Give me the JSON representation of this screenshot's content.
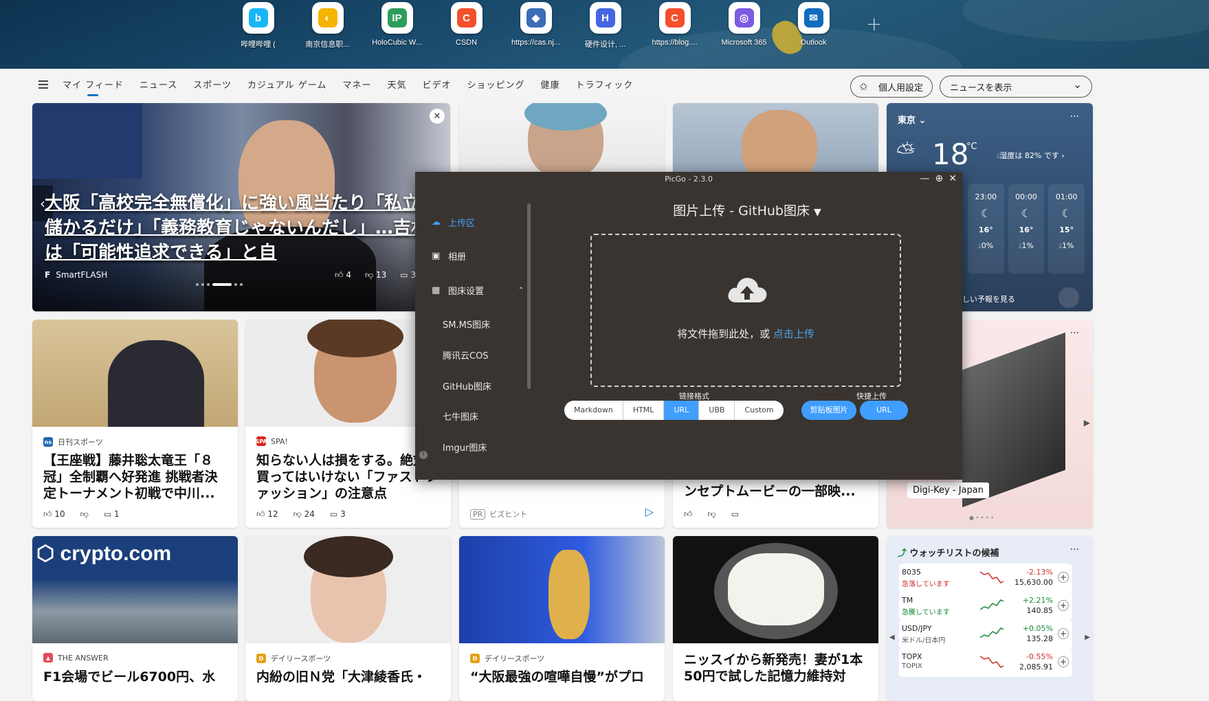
{
  "shortcuts": [
    {
      "label": "哔哩哔哩 (",
      "icon": "bilibili-icon",
      "color": "#19b6f6",
      "glyph": "b"
    },
    {
      "label": "南京信息职...",
      "icon": "njcit-icon",
      "color": "#f5b400",
      "glyph": "◐"
    },
    {
      "label": "HoloCubic W...",
      "icon": "holocubic-icon",
      "color": "#2e9d5c",
      "glyph": "IP"
    },
    {
      "label": "CSDN",
      "icon": "csdn-icon",
      "color": "#f44f2b",
      "glyph": "C"
    },
    {
      "label": "https://cas.nj...",
      "icon": "cas-icon",
      "color": "#3b6cb5",
      "glyph": "◆"
    },
    {
      "label": "硬件设计, ...",
      "icon": "hardware-icon",
      "color": "#4466e0",
      "glyph": "H"
    },
    {
      "label": "https://blog....",
      "icon": "blog-icon",
      "color": "#f44f2b",
      "glyph": "C"
    },
    {
      "label": "Microsoft 365",
      "icon": "microsoft365-icon",
      "color": "#7b5be0",
      "glyph": "◎"
    },
    {
      "label": "Outlook",
      "icon": "outlook-icon",
      "color": "#0f6cbd",
      "glyph": "✉"
    }
  ],
  "nav": {
    "items": [
      "マイ フィード",
      "ニュース",
      "スポーツ",
      "カジュアル ゲーム",
      "マネー",
      "天気",
      "ビデオ",
      "ショッピング",
      "健康",
      "トラフィック"
    ],
    "personalize": "個人用設定",
    "news_select": "ニュースを表示"
  },
  "hero_card": {
    "title": "大阪「高校完全無償化」に強い風当たり「私立校が儲かるだけ」「義務教育じゃないんだし」…吉村知事は「可能性追求できる」と自",
    "source": "SmartFLASH",
    "likes": "4",
    "dislikes": "13",
    "comments": "3"
  },
  "cards": [
    {
      "source": "日刊スポーツ",
      "title": "【王座戦】藤井聡太竜王「８冠」全制覇へ好発進 挑戦者決定トーナメント初戦で中川...",
      "likes": "10",
      "comments": "1"
    },
    {
      "source": "SPA!",
      "title": "知らない人は損をする。絶対に買ってはいけない「ファストファッション」の注意点",
      "likes": "12",
      "dislikes": "24",
      "comments": "3"
    },
    {
      "source": "ビズヒント",
      "badge": "PR"
    },
    {
      "title": "ンセプトムービーの一部映..."
    },
    {
      "source": "THE ANSWER",
      "title": "F1会場でビール6700円、水"
    },
    {
      "source": "デイリースポーツ",
      "title": "内紛の旧Ｎ党「大津綾香氏・"
    },
    {
      "source": "デイリースポーツ",
      "title": "“大阪最強の喧嘩自慢”がプロ"
    },
    {
      "title": "ニッスイから新発売！妻が1本50円で試した記憶力維持対"
    }
  ],
  "weather": {
    "city": "東京",
    "temp": "18",
    "unit": "°C",
    "humidity": "湿度は 82% です",
    "hours": [
      {
        "time": "23:00",
        "temp": "16°",
        "rain": "0%"
      },
      {
        "time": "00:00",
        "temp": "16°",
        "rain": "1%"
      },
      {
        "time": "01:00",
        "temp": "15°",
        "rain": "1%"
      }
    ],
    "more": "しい予報を見る"
  },
  "ad_card": {
    "label": "Digi-Key - Japan"
  },
  "watchlist": {
    "title": "ウォッチリストの候補",
    "rows": [
      {
        "symbol": "8035",
        "sub": "急落しています",
        "change": "-2.13%",
        "price": "15,630.00",
        "up": false
      },
      {
        "symbol": "TM",
        "sub": "急騰しています",
        "change": "+2.21%",
        "price": "140.85",
        "up": true
      },
      {
        "symbol": "USD/JPY",
        "sub": "米ドル/日本円",
        "change": "+0.05%",
        "price": "135.28",
        "up": true
      },
      {
        "symbol": "TOPX",
        "sub": "TOPIX",
        "change": "-0.55%",
        "price": "2,085.91",
        "up": false
      }
    ]
  },
  "picgo": {
    "window_title": "PicGo - 2.3.0",
    "menu": [
      "上传区",
      "相册",
      "图床设置"
    ],
    "sub_menu": [
      "SM.MS图床",
      "腾讯云COS",
      "GitHub图床",
      "七牛图床",
      "Imgur图床"
    ],
    "main_title": "图片上传 - GitHub图床",
    "drop_text": "将文件拖到此处，或 ",
    "drop_link": "点击上传",
    "link_format_label": "链接格式",
    "formats": [
      "Markdown",
      "HTML",
      "URL",
      "UBB",
      "Custom"
    ],
    "active_format": "URL",
    "quick_upload_label": "快捷上传",
    "clipboard_btn": "剪贴板图片",
    "url_btn": "URL"
  },
  "colors": {
    "accent": "#1a73c8",
    "picgo_blue": "#409eff",
    "picgo_bg": "#3a3430",
    "down": "#d0302c",
    "up": "#1a8a3c"
  }
}
